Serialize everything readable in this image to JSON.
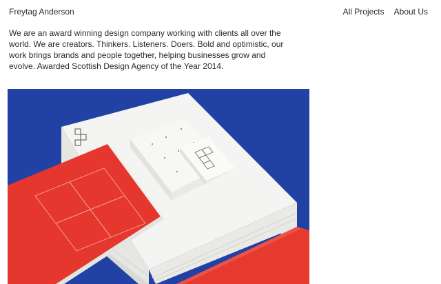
{
  "header": {
    "brand": "Freytag Anderson",
    "nav": [
      {
        "label": "All Projects"
      },
      {
        "label": "About Us"
      }
    ]
  },
  "intro": {
    "text": "We are an award winning design company working with clients all over the world. We are creators. Thinkers. Listeners. Doers. Bold and optimistic, our work brings brands and people together, helping businesses grow and evolve. Awarded Scottish Design Agency of the Year 2014."
  },
  "hero": {
    "subject": "brand-stationery-photo",
    "colors": {
      "background_blue": "#1f3fa0",
      "paper_white": "#f4f4f2",
      "accent_red": "#e5372d"
    }
  }
}
